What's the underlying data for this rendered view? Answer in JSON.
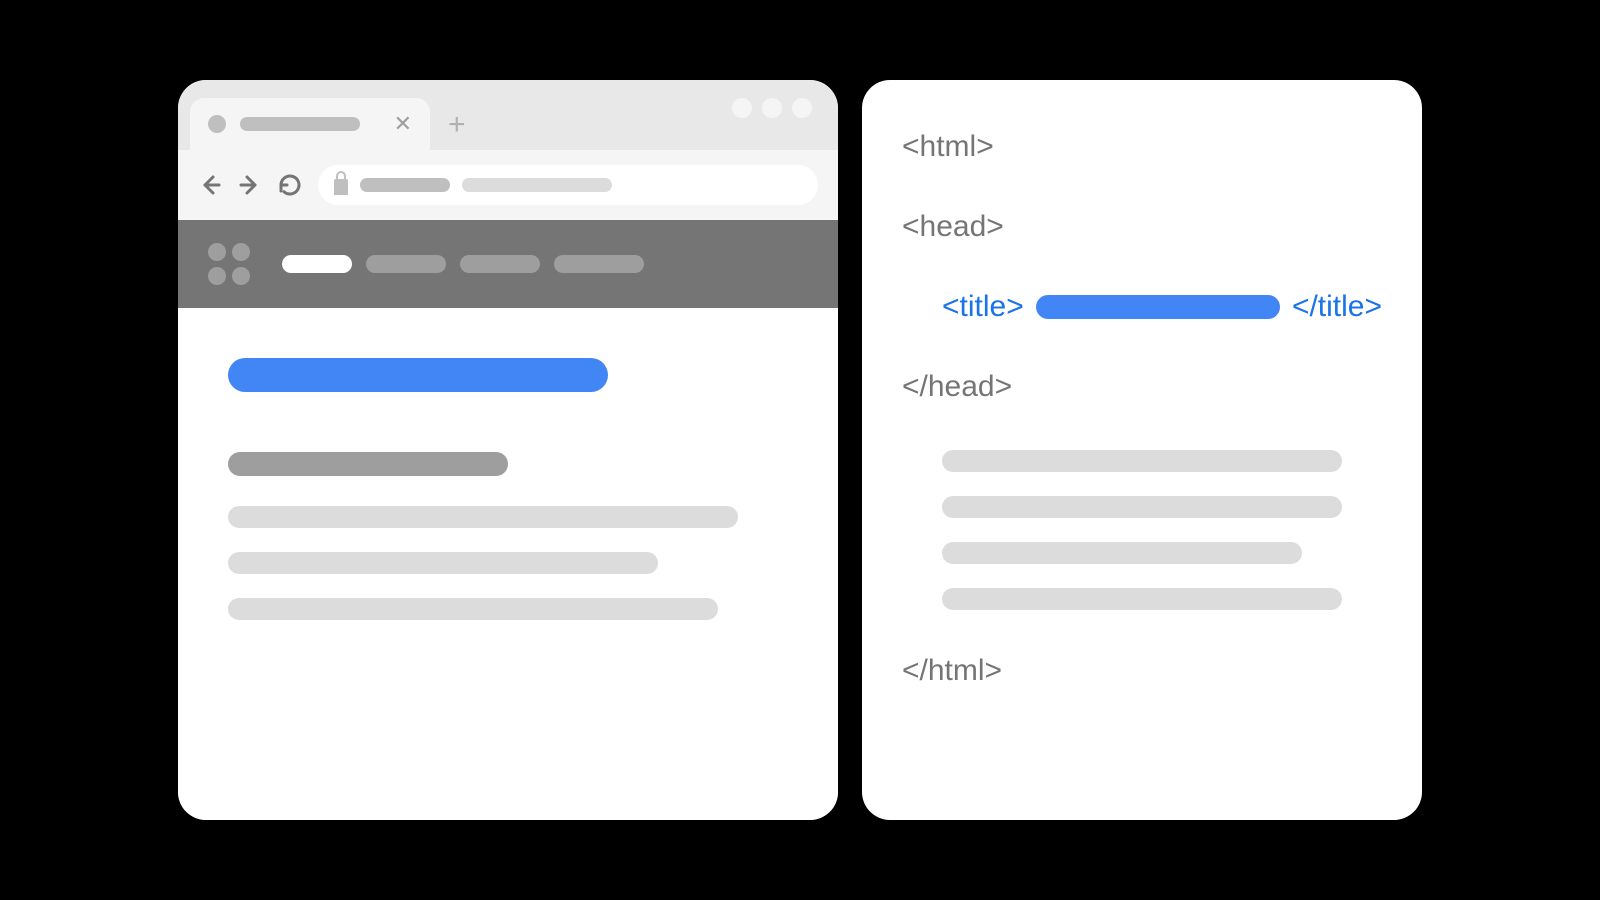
{
  "code": {
    "html_open": "<html>",
    "head_open": "<head>",
    "title_open": "<title>",
    "title_close": "</title>",
    "head_close": "</head>",
    "html_close": "</html>"
  },
  "colors": {
    "accent_blue": "#4285f4",
    "tag_blue": "#1a73e8",
    "gray_dark": "#757575",
    "gray_mid": "#9e9e9e",
    "gray_light": "#dcdcdc",
    "chrome_bg": "#e8e8e8"
  }
}
